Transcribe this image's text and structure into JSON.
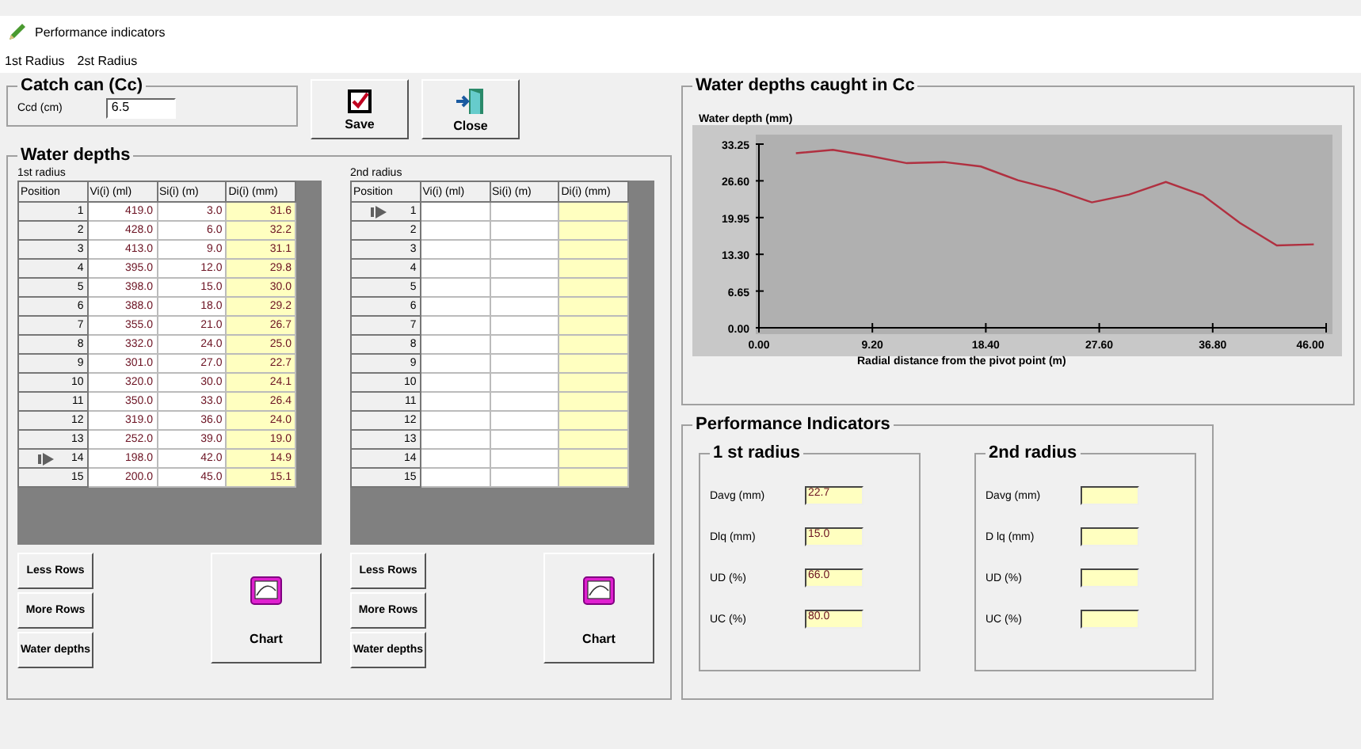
{
  "window": {
    "title": "Performance indicators"
  },
  "menu": [
    "1st Radius",
    "2st Radius"
  ],
  "catch_can": {
    "title": "Catch can (Cc)",
    "label": "Ccd (cm)",
    "value": "6.5"
  },
  "buttons": [
    {
      "kind": "save",
      "label": "Save"
    },
    {
      "kind": "close",
      "label": "Close"
    }
  ],
  "water_depths": {
    "title": "Water depths",
    "panels": [
      {
        "title": "1st radius",
        "columns": [
          "Position",
          "Vi(i) (ml)",
          "Si(i) (m)",
          "Di(i) (mm)"
        ],
        "rows": [
          {
            "current": false,
            "cells": [
              "1",
              "419.0",
              "3.0",
              "31.6"
            ]
          },
          {
            "current": false,
            "cells": [
              "2",
              "428.0",
              "6.0",
              "32.2"
            ]
          },
          {
            "current": false,
            "cells": [
              "3",
              "413.0",
              "9.0",
              "31.1"
            ]
          },
          {
            "current": false,
            "cells": [
              "4",
              "395.0",
              "12.0",
              "29.8"
            ]
          },
          {
            "current": false,
            "cells": [
              "5",
              "398.0",
              "15.0",
              "30.0"
            ]
          },
          {
            "current": false,
            "cells": [
              "6",
              "388.0",
              "18.0",
              "29.2"
            ]
          },
          {
            "current": false,
            "cells": [
              "7",
              "355.0",
              "21.0",
              "26.7"
            ]
          },
          {
            "current": false,
            "cells": [
              "8",
              "332.0",
              "24.0",
              "25.0"
            ]
          },
          {
            "current": false,
            "cells": [
              "9",
              "301.0",
              "27.0",
              "22.7"
            ]
          },
          {
            "current": false,
            "cells": [
              "10",
              "320.0",
              "30.0",
              "24.1"
            ]
          },
          {
            "current": false,
            "cells": [
              "11",
              "350.0",
              "33.0",
              "26.4"
            ]
          },
          {
            "current": false,
            "cells": [
              "12",
              "319.0",
              "36.0",
              "24.0"
            ]
          },
          {
            "current": false,
            "cells": [
              "13",
              "252.0",
              "39.0",
              "19.0"
            ]
          },
          {
            "current": true,
            "cells": [
              "14",
              "198.0",
              "42.0",
              "14.9"
            ]
          },
          {
            "current": false,
            "cells": [
              "15",
              "200.0",
              "45.0",
              "15.1"
            ]
          }
        ],
        "side_buttons": [
          "Less Rows",
          "More Rows",
          "Water depths"
        ],
        "chart_button": "Chart"
      },
      {
        "title": "2nd radius",
        "columns": [
          "Position",
          "Vi(i) (ml)",
          "Si(i) (m)",
          "Di(i) (mm)"
        ],
        "rows": [
          {
            "current": true,
            "cells": [
              "1"
            ]
          },
          {
            "current": false,
            "cells": [
              "2"
            ]
          },
          {
            "current": false,
            "cells": [
              "3"
            ]
          },
          {
            "current": false,
            "cells": [
              "4"
            ]
          },
          {
            "current": false,
            "cells": [
              "5"
            ]
          },
          {
            "current": false,
            "cells": [
              "6"
            ]
          },
          {
            "current": false,
            "cells": [
              "7"
            ]
          },
          {
            "current": false,
            "cells": [
              "8"
            ]
          },
          {
            "current": false,
            "cells": [
              "9"
            ]
          },
          {
            "current": false,
            "cells": [
              "10"
            ]
          },
          {
            "current": false,
            "cells": [
              "11"
            ]
          },
          {
            "current": false,
            "cells": [
              "12"
            ]
          },
          {
            "current": false,
            "cells": [
              "13"
            ]
          },
          {
            "current": false,
            "cells": [
              "14"
            ]
          },
          {
            "current": false,
            "cells": [
              "15"
            ]
          }
        ],
        "side_buttons": [
          "Less Rows",
          "More Rows",
          "Water depths"
        ],
        "chart_button": "Chart"
      }
    ]
  },
  "chart_panel": {
    "title": "Water depths caught in Cc",
    "chart_data": {
      "type": "line",
      "xlabel": "Radial distance from the pivot point (m)",
      "ylabel": "Water depth (mm)",
      "x": [
        3,
        6,
        9,
        12,
        15,
        18,
        21,
        24,
        27,
        30,
        33,
        36,
        39,
        42,
        45
      ],
      "series": [
        {
          "color": "#b03040",
          "values": [
            31.6,
            32.2,
            31.1,
            29.8,
            30.0,
            29.2,
            26.7,
            25.0,
            22.7,
            24.1,
            26.4,
            24.0,
            19.0,
            14.9,
            15.1
          ]
        }
      ],
      "xlim": [
        0,
        46
      ],
      "ylim": [
        0,
        33.25
      ],
      "xticks": [
        {
          "value": 0,
          "label": "0.00"
        },
        {
          "value": 9.2,
          "label": "9.20"
        },
        {
          "value": 18.4,
          "label": "18.40"
        },
        {
          "value": 27.6,
          "label": "27.60"
        },
        {
          "value": 36.8,
          "label": "36.80"
        },
        {
          "value": 46,
          "label": "46.00"
        }
      ],
      "yticks": [
        {
          "value": 0,
          "label": "0.00"
        },
        {
          "value": 6.65,
          "label": "6.65"
        },
        {
          "value": 13.3,
          "label": "13.30"
        },
        {
          "value": 19.95,
          "label": "19.95"
        },
        {
          "value": 26.6,
          "label": "26.60"
        },
        {
          "value": 33.25,
          "label": "33.25"
        }
      ]
    }
  },
  "performance": {
    "title": "Performance Indicators",
    "groups": [
      {
        "title": "1 st radius",
        "fields": [
          {
            "label": "Davg (mm)",
            "value": "22.7"
          },
          {
            "label": "Dlq (mm)",
            "value": "15.0"
          },
          {
            "label": "UD (%)",
            "value": "66.0"
          },
          {
            "label": "UC (%)",
            "value": "80.0"
          }
        ]
      },
      {
        "title": "2nd radius",
        "fields": [
          {
            "label": "Davg (mm)"
          },
          {
            "label": "D lq (mm)"
          },
          {
            "label": "UD (%)"
          },
          {
            "label": "UC (%)"
          }
        ]
      }
    ]
  }
}
